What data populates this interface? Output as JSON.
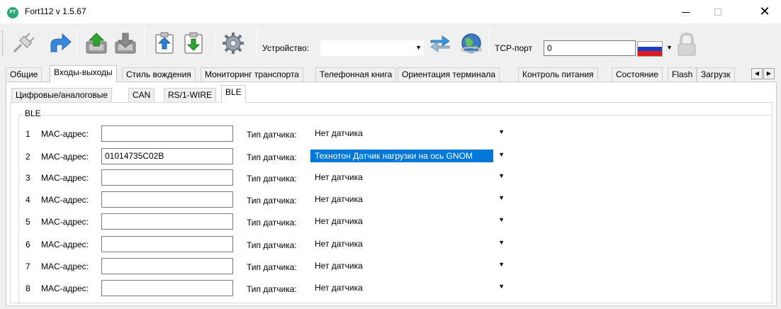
{
  "window": {
    "app_icon_text": "FT",
    "title": "Fort112 v 1.5.67",
    "minimize_label": "",
    "close_label": "✕"
  },
  "toolbar": {
    "device_label": "Устройство:",
    "device_value": "",
    "tcp_label": "TCP-порт",
    "tcp_value": "0",
    "icons": [
      "plug-icon",
      "connect-arrow-icon",
      "upload-green-icon",
      "download-gray-icon",
      "clipboard-upload-icon",
      "clipboard-download-icon",
      "gear-icon",
      "sync-icon",
      "globe-icon",
      "lock-icon"
    ],
    "flag_colors": [
      "#ffffff",
      "#1c3fc8",
      "#e01a1a"
    ]
  },
  "tabs": [
    {
      "label": "Общие",
      "active": false
    },
    {
      "label": "Входы-выходы",
      "active": true
    },
    {
      "label": "Стиль вождения",
      "active": false
    },
    {
      "label": "Мониторинг транспорта",
      "active": false
    },
    {
      "label": "Телефонная книга",
      "active": false
    },
    {
      "label": "Ориентация терминала",
      "active": false
    },
    {
      "label": "Контроль питания",
      "active": false
    },
    {
      "label": "Состояние",
      "active": false
    },
    {
      "label": "Flash",
      "active": false
    },
    {
      "label": "Загрузк",
      "active": false
    }
  ],
  "subtabs": [
    {
      "label": "Цифровые/аналоговые",
      "active": false
    },
    {
      "label": "CAN",
      "active": false
    },
    {
      "label": "RS/1-WIRE",
      "active": false
    },
    {
      "label": "BLE",
      "active": true
    }
  ],
  "ble": {
    "group_title": "BLE",
    "mac_label": "MAC-адрес:",
    "type_label": "Тип датчика:",
    "rows": [
      {
        "num": "1",
        "mac": "",
        "type": "Нет датчика",
        "selected": false
      },
      {
        "num": "2",
        "mac": "01014735C02B",
        "type": "Технотон Датчик нагрузки на ось GNOM",
        "selected": true
      },
      {
        "num": "3",
        "mac": "",
        "type": "Нет датчика",
        "selected": false
      },
      {
        "num": "4",
        "mac": "",
        "type": "Нет датчика",
        "selected": false
      },
      {
        "num": "5",
        "mac": "",
        "type": "Нет датчика",
        "selected": false
      },
      {
        "num": "6",
        "mac": "",
        "type": "Нет датчика",
        "selected": false
      },
      {
        "num": "7",
        "mac": "",
        "type": "Нет датчика",
        "selected": false
      },
      {
        "num": "8",
        "mac": "",
        "type": "Нет датчика",
        "selected": false
      }
    ]
  },
  "colors": {
    "selection": "#0078d7",
    "window_bg": "#f0f0f0"
  }
}
